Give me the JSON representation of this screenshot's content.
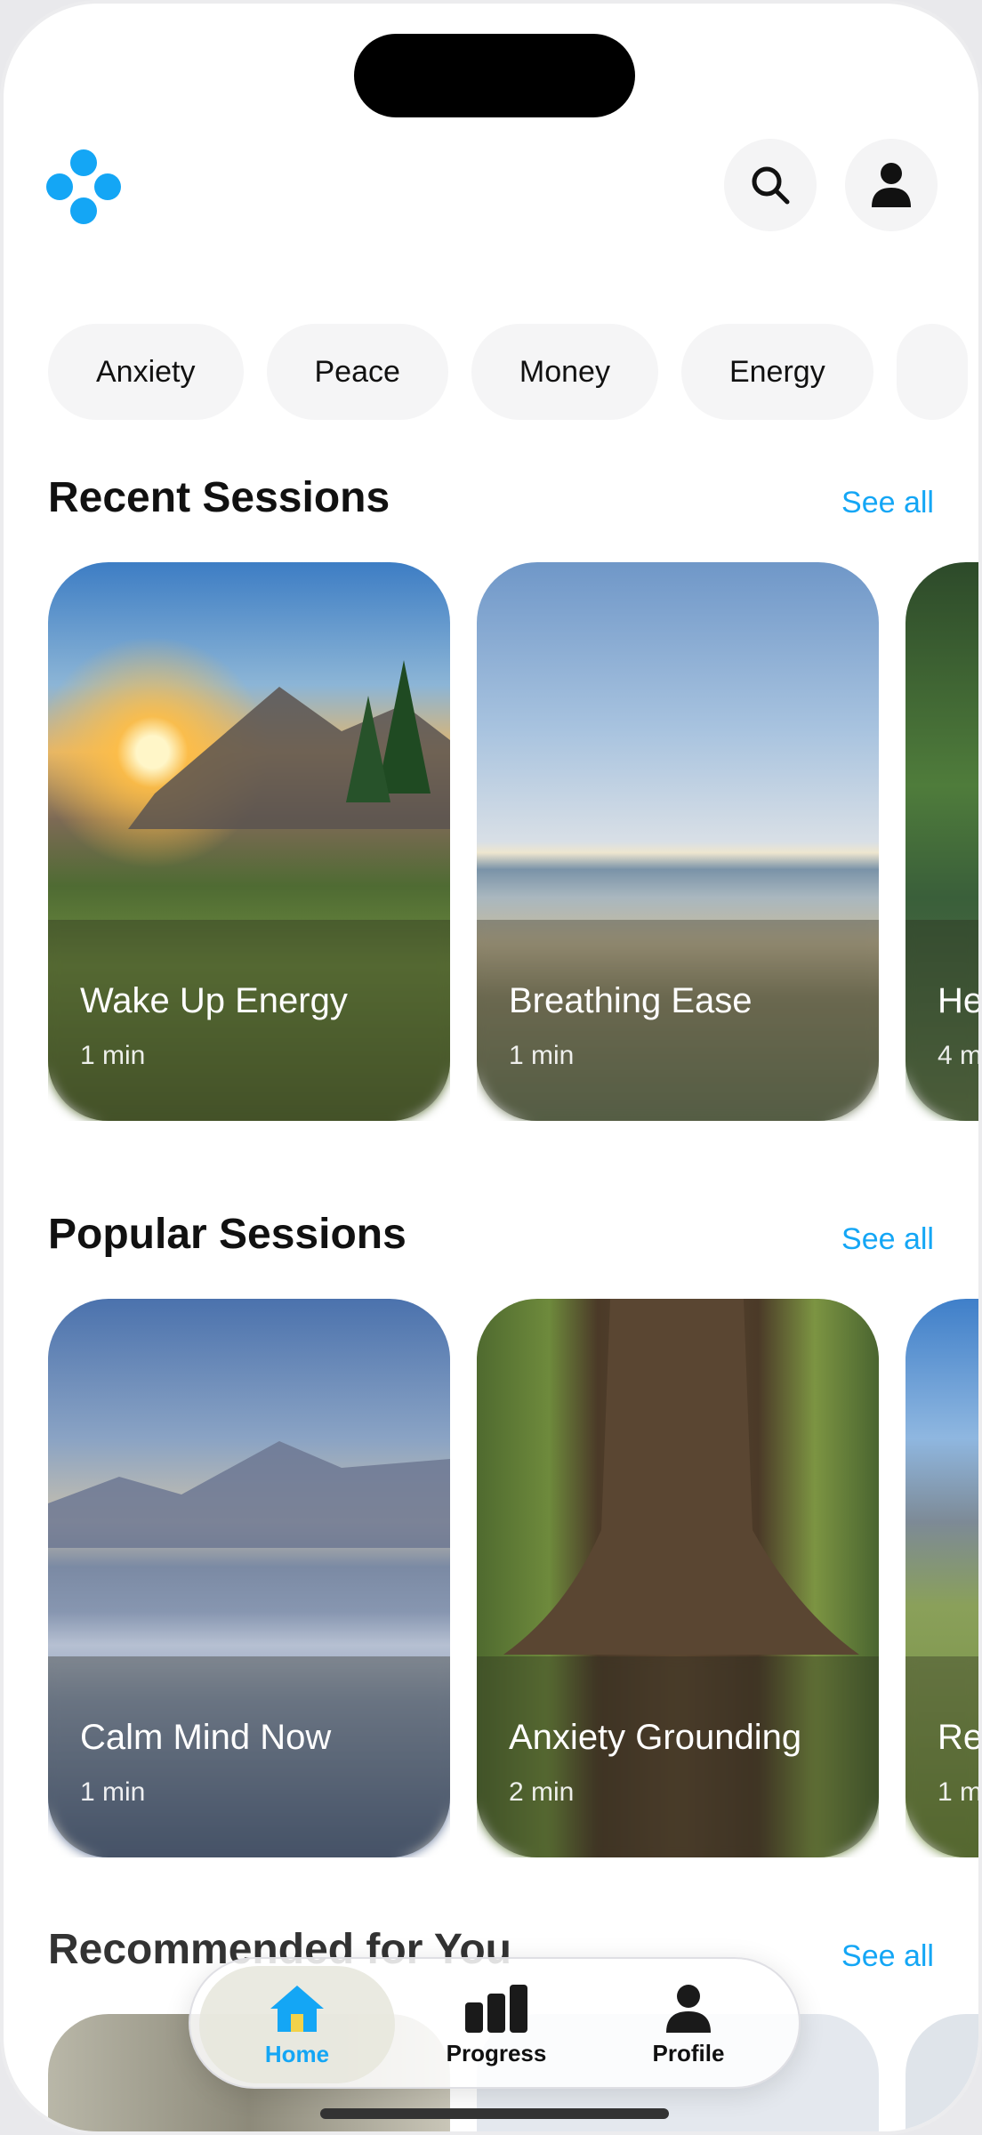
{
  "header": {
    "search_icon": "search-icon",
    "profile_icon": "person-icon"
  },
  "chips": [
    "Anxiety",
    "Peace",
    "Money",
    "Energy"
  ],
  "recent": {
    "title": "Recent Sessions",
    "see_all": "See all",
    "cards": [
      {
        "title": "Wake Up Energy",
        "duration": "1 min"
      },
      {
        "title": "Breathing Ease",
        "duration": "1 min"
      },
      {
        "title": "He",
        "duration": "4 m"
      }
    ]
  },
  "popular": {
    "title": "Popular Sessions",
    "see_all": "See all",
    "cards": [
      {
        "title": "Calm Mind Now",
        "duration": "1 min"
      },
      {
        "title": "Anxiety Grounding",
        "duration": "2 min"
      },
      {
        "title": "Re",
        "duration": "1 m"
      }
    ]
  },
  "recommended": {
    "title": "Recommended for You",
    "see_all": "See all"
  },
  "tabs": [
    {
      "label": "Home",
      "icon": "home-icon",
      "active": true
    },
    {
      "label": "Progress",
      "icon": "bar-chart-icon",
      "active": false
    },
    {
      "label": "Profile",
      "icon": "person-icon",
      "active": false
    }
  ],
  "colors": {
    "accent": "#14a6f5",
    "text": "#111111",
    "chip_bg": "#f5f5f6"
  }
}
